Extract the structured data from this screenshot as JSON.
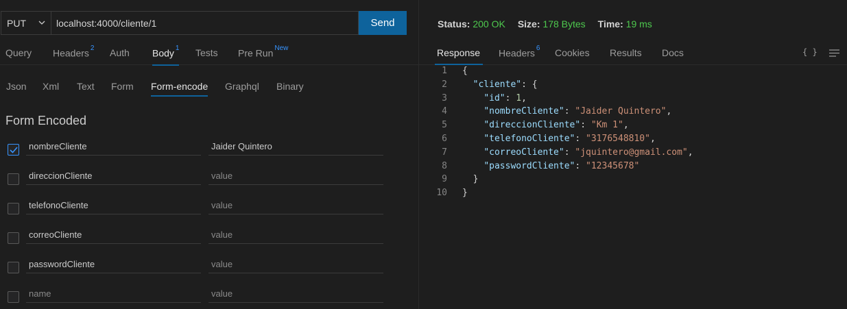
{
  "request": {
    "method": "PUT",
    "url": "localhost:4000/cliente/1",
    "send_label": "Send"
  },
  "request_tabs": [
    {
      "label": "Query",
      "badge": ""
    },
    {
      "label": "Headers",
      "badge": "2"
    },
    {
      "label": "Auth",
      "badge": ""
    },
    {
      "label": "Body",
      "badge": "1"
    },
    {
      "label": "Tests",
      "badge": ""
    },
    {
      "label": "Pre Run",
      "badge": "New"
    }
  ],
  "body_tabs": [
    "Json",
    "Xml",
    "Text",
    "Form",
    "Form-encode",
    "Graphql",
    "Binary"
  ],
  "form": {
    "title": "Form Encoded",
    "rows": [
      {
        "key": "nombreCliente",
        "value": "Jaider Quintero",
        "checked": true
      },
      {
        "key": "direccionCliente",
        "value": "value",
        "checked": false
      },
      {
        "key": "telefonoCliente",
        "value": "value",
        "checked": false
      },
      {
        "key": "correoCliente",
        "value": "value",
        "checked": false
      },
      {
        "key": "passwordCliente",
        "value": "value",
        "checked": false
      },
      {
        "key": "name",
        "value": "value",
        "checked": false
      }
    ]
  },
  "response": {
    "status_label": "Status:",
    "status_value": "200 OK",
    "size_label": "Size:",
    "size_value": "178 Bytes",
    "time_label": "Time:",
    "time_value": "19 ms"
  },
  "response_tabs": [
    {
      "label": "Response",
      "badge": ""
    },
    {
      "label": "Headers",
      "badge": "6"
    },
    {
      "label": "Cookies",
      "badge": ""
    },
    {
      "label": "Results",
      "badge": ""
    },
    {
      "label": "Docs",
      "badge": ""
    }
  ],
  "icons": {
    "format": "braces-icon",
    "wrap": "wrap-lines-icon"
  },
  "code_lines": [
    "1",
    "2",
    "3",
    "4",
    "5",
    "6",
    "7",
    "8",
    "9",
    "10"
  ],
  "json_body": {
    "cliente_key": "cliente",
    "id_key": "id",
    "id_val": "1",
    "nombre_key": "nombreCliente",
    "nombre_val": "Jaider Quintero",
    "direccion_key": "direccionCliente",
    "direccion_val": "Km 1",
    "telefono_key": "telefonoCliente",
    "telefono_val": "3176548810",
    "correo_key": "correoCliente",
    "correo_val": "jquintero@gmail.com",
    "password_key": "passwordCliente",
    "password_val": "12345678"
  },
  "colors": {
    "accent": "#0e639c",
    "status_ok": "#4ec94e",
    "badge": "#3794ff"
  }
}
